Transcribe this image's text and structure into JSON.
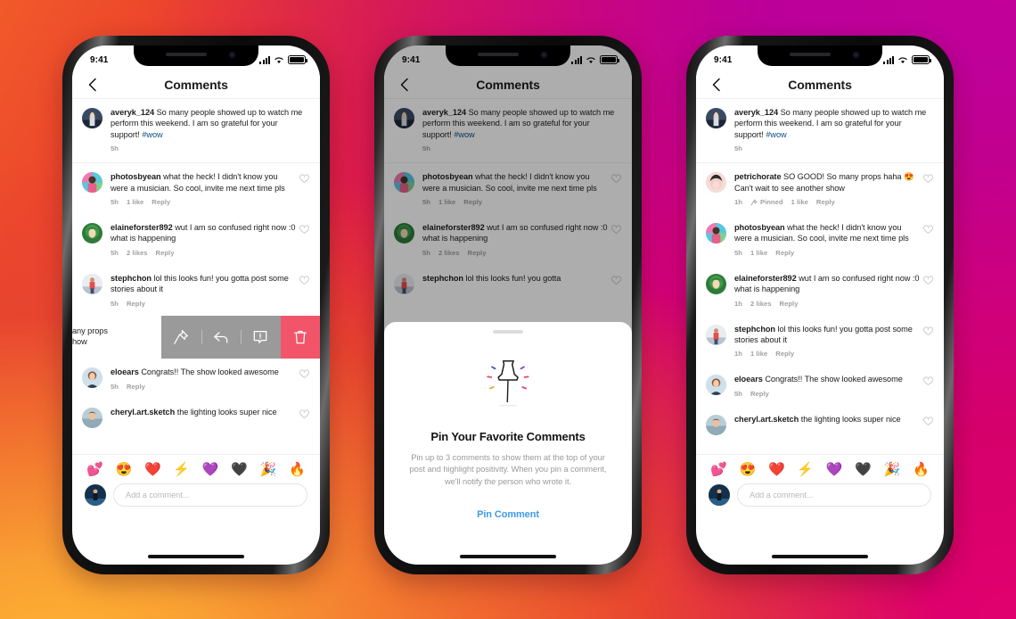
{
  "status_bar": {
    "time": "9:41",
    "signal_icon": "cellular-signal-icon",
    "wifi_icon": "wifi-icon",
    "battery_icon": "battery-icon"
  },
  "nav": {
    "title": "Comments",
    "back_icon": "chevron-left-icon"
  },
  "colors": {
    "link_blue": "#0d4b86",
    "cta_blue": "#3E9BE8",
    "delete_red": "#F2556A",
    "action_gray": "#9a9a9a",
    "meta_gray": "#a0a0a0"
  },
  "emoji_bar": [
    "💕",
    "😍",
    "❤️",
    "⚡",
    "💜",
    "🖤",
    "🎉",
    "🔥"
  ],
  "composer": {
    "placeholder": "Add a comment...",
    "avatar": "user-avatar"
  },
  "swipe_actions": [
    {
      "name": "pin",
      "icon": "pin-icon",
      "label": "Pin"
    },
    {
      "name": "reply",
      "icon": "reply-arrow-icon",
      "label": "Reply"
    },
    {
      "name": "report",
      "icon": "report-icon",
      "label": "Report"
    },
    {
      "name": "delete",
      "icon": "trash-icon",
      "label": "Delete"
    }
  ],
  "phone1": {
    "partial_comment": {
      "line1": "any props",
      "line2": "how"
    },
    "comments": [
      {
        "user": "averyk_124",
        "text": " So many people showed up to watch me perform this weekend. I am so grateful for your support! ",
        "tag": "#wow",
        "time": "5h",
        "likes": "",
        "reply": "",
        "has_heart": false,
        "first": true
      },
      {
        "user": "photosbyean",
        "text": " what the heck! I didn't know you were a musician. So cool, invite me next time pls",
        "tag": "",
        "time": "5h",
        "likes": "1 like",
        "reply": "Reply",
        "has_heart": true
      },
      {
        "user": "elaineforster892",
        "text": " wut I am so confused right now :0 what is happening",
        "tag": "",
        "time": "5h",
        "likes": "2 likes",
        "reply": "Reply",
        "has_heart": true
      },
      {
        "user": "stephchon",
        "text": " lol this looks fun! you gotta post some stories about it",
        "tag": "",
        "time": "5h",
        "likes": "",
        "reply": "Reply",
        "has_heart": true
      },
      {
        "user": "eloears",
        "text": " Congrats!! The show looked awesome",
        "tag": "",
        "time": "5h",
        "likes": "",
        "reply": "Reply",
        "has_heart": true
      },
      {
        "user": "cheryl.art.sketch",
        "text": " the lighting looks super nice",
        "tag": "",
        "time": "",
        "likes": "",
        "reply": "",
        "has_heart": true
      }
    ]
  },
  "phone2": {
    "comments": [
      {
        "user": "averyk_124",
        "text": " So many people showed up to watch me perform this weekend. I am so grateful for your support! ",
        "tag": "#wow",
        "time": "5h",
        "likes": "",
        "reply": "",
        "has_heart": false,
        "first": true
      },
      {
        "user": "photosbyean",
        "text": " what the heck! I didn't know you were a musician. So cool, invite me next time pls",
        "tag": "",
        "time": "5h",
        "likes": "1 like",
        "reply": "Reply",
        "has_heart": true
      },
      {
        "user": "elaineforster892",
        "text": " wut I am so confused right now :0 what is happening",
        "tag": "",
        "time": "5h",
        "likes": "2 likes",
        "reply": "Reply",
        "has_heart": true
      },
      {
        "user": "stephchon",
        "text": " lol this looks fun! you gotta",
        "tag": "",
        "time": "",
        "likes": "",
        "reply": "",
        "has_heart": true
      }
    ],
    "sheet": {
      "illustration": "push-pin-illustration",
      "title": "Pin Your Favorite Comments",
      "body": "Pin up to 3 comments to show them at the top of your post and highlight positivity. When you pin a comment, we'll notify the person who wrote it.",
      "cta": "Pin Comment"
    }
  },
  "phone3": {
    "comments": [
      {
        "user": "averyk_124",
        "text": " So many people showed up to watch me perform this weekend. I am so grateful for your support! ",
        "tag": "#wow",
        "time": "5h",
        "likes": "",
        "reply": "",
        "has_heart": false,
        "first": true
      },
      {
        "user": "petrichorate",
        "text": " SO GOOD! So many props haha 😍 Can't wait to see another show",
        "tag": "",
        "time": "1h",
        "pinned": "Pinned",
        "likes": "1 like",
        "reply": "Reply",
        "has_heart": true
      },
      {
        "user": "photosbyean",
        "text": " what the heck! I didn't know you were a musician. So cool, invite me next time pls",
        "tag": "",
        "time": "5h",
        "likes": "1 like",
        "reply": "Reply",
        "has_heart": true
      },
      {
        "user": "elaineforster892",
        "text": " wut I am so confused right now :0 what is happening",
        "tag": "",
        "time": "1h",
        "likes": "2 likes",
        "reply": "Reply",
        "has_heart": true
      },
      {
        "user": "stephchon",
        "text": " lol this looks fun! you gotta post some stories about it",
        "tag": "",
        "time": "1h",
        "likes": "1 like",
        "reply": "Reply",
        "has_heart": true
      },
      {
        "user": "eloears",
        "text": " Congrats!! The show looked awesome",
        "tag": "",
        "time": "5h",
        "likes": "",
        "reply": "Reply",
        "has_heart": true
      },
      {
        "user": "cheryl.art.sketch",
        "text": " the lighting looks super nice",
        "tag": "",
        "time": "",
        "likes": "",
        "reply": "",
        "has_heart": true
      }
    ]
  }
}
